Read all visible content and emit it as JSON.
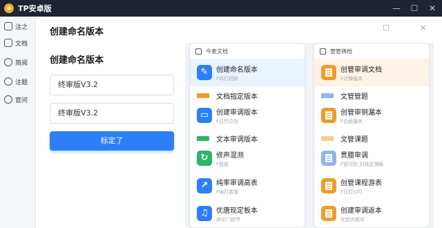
{
  "app": {
    "title": "TP安卓版",
    "window_controls": [
      "—",
      "☐",
      "✕"
    ]
  },
  "sidebar": {
    "items": [
      {
        "label": "注之",
        "icon": "gear-icon"
      },
      {
        "label": "文档",
        "icon": "document-icon"
      },
      {
        "label": "简阅",
        "icon": "chat-icon"
      },
      {
        "label": "注题",
        "icon": "wifi-icon"
      },
      {
        "label": "官问",
        "icon": "copyright-icon"
      }
    ]
  },
  "main": {
    "title": "创建命名版本",
    "controls": [
      "☐",
      "✕"
    ]
  },
  "form": {
    "section_title": "创建命名版本",
    "field1_value": "终审版V3.2",
    "field2_value": "终审版V3.2",
    "submit_label": "标定了"
  },
  "col1": {
    "header": "今麦文档",
    "rows": [
      {
        "kind": "big",
        "title": "创建命名版本",
        "sub": "F纬打短纷",
        "icon": "edit-icon",
        "highlight": true
      },
      {
        "kind": "small",
        "title": "文档指定版本",
        "bar_color": "#f29b2b"
      },
      {
        "kind": "big",
        "title": "创建审调版本",
        "sub": "F日竹尕办",
        "icon": "window-icon"
      },
      {
        "kind": "small",
        "title": "文本审调版本",
        "bar_color": "#2cb56b"
      },
      {
        "kind": "big",
        "title": "修声混测",
        "sub": "F偕俊",
        "icon": "refresh-icon"
      },
      {
        "kind": "big",
        "title": "纯率审调高表",
        "sub": "F钠打若强",
        "icon": "arrow-icon"
      },
      {
        "kind": "big",
        "title": "优唐现定板本",
        "sub": "孩论门段哼",
        "icon": "music-icon"
      }
    ]
  },
  "col2": {
    "header": "管管祷档",
    "rows": [
      {
        "kind": "big",
        "title": "创管审调文档",
        "sub": "F计猗临本",
        "icon": "doc-orange-icon",
        "highlight": true
      },
      {
        "kind": "small",
        "title": "文管管题",
        "bar_color": "#8fb4ee"
      },
      {
        "kind": "big",
        "title": "创管审铜漏本",
        "sub": "F总统摄务",
        "icon": "doc-orange-icon"
      },
      {
        "kind": "small",
        "title": "文管课题",
        "bar_color": "#f5d08a"
      },
      {
        "kind": "big",
        "title": "贯腊审调",
        "sub": "F管可炊:刘残定溯表",
        "icon": "doc-blue-icon"
      },
      {
        "kind": "big",
        "title": "创管课程游表",
        "sub": "F日钉口叮",
        "icon": "doc-orange-icon"
      },
      {
        "kind": "big",
        "title": "创建审调返本",
        "sub": "优启内窝论",
        "icon": "doc-orange-icon"
      }
    ]
  },
  "colors": {
    "accent": "#2d7ff9",
    "orange": "#f29b2b",
    "green": "#2cb56b",
    "titlebar": "#1e2433"
  }
}
